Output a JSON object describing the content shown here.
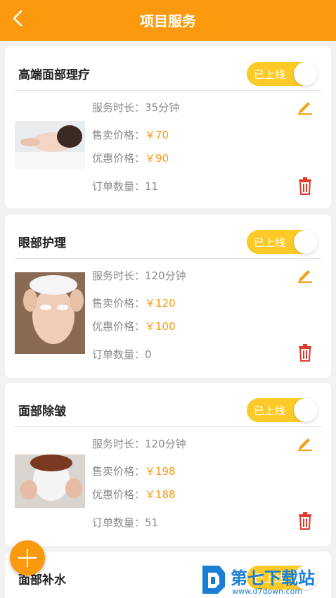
{
  "header": {
    "title": "项目服务"
  },
  "labels": {
    "duration": "服务时长：",
    "sale": "售卖价格：",
    "promo": "优惠价格：",
    "orders": "订单数量："
  },
  "cards": [
    {
      "title": "高端面部理疗",
      "status": "已上线",
      "duration": "35分钟",
      "sale_price": "￥70",
      "promo_price": "￥90",
      "orders": "11"
    },
    {
      "title": "眼部护理",
      "status": "已上线",
      "duration": "120分钟",
      "sale_price": "￥120",
      "promo_price": "￥100",
      "orders": "0"
    },
    {
      "title": "面部除皱",
      "status": "已上线",
      "duration": "120分钟",
      "sale_price": "￥198",
      "promo_price": "￥188",
      "orders": "51"
    },
    {
      "title": "面部补水",
      "status": "已上线"
    }
  ],
  "watermark": {
    "text": "第七下载站",
    "url": "www.d7down.com"
  },
  "colors": {
    "accent": "#fb9a0e",
    "toggle": "#fbc928",
    "price": "#f59a12",
    "edit": "#f0a21a",
    "delete": "#e23b2e"
  }
}
